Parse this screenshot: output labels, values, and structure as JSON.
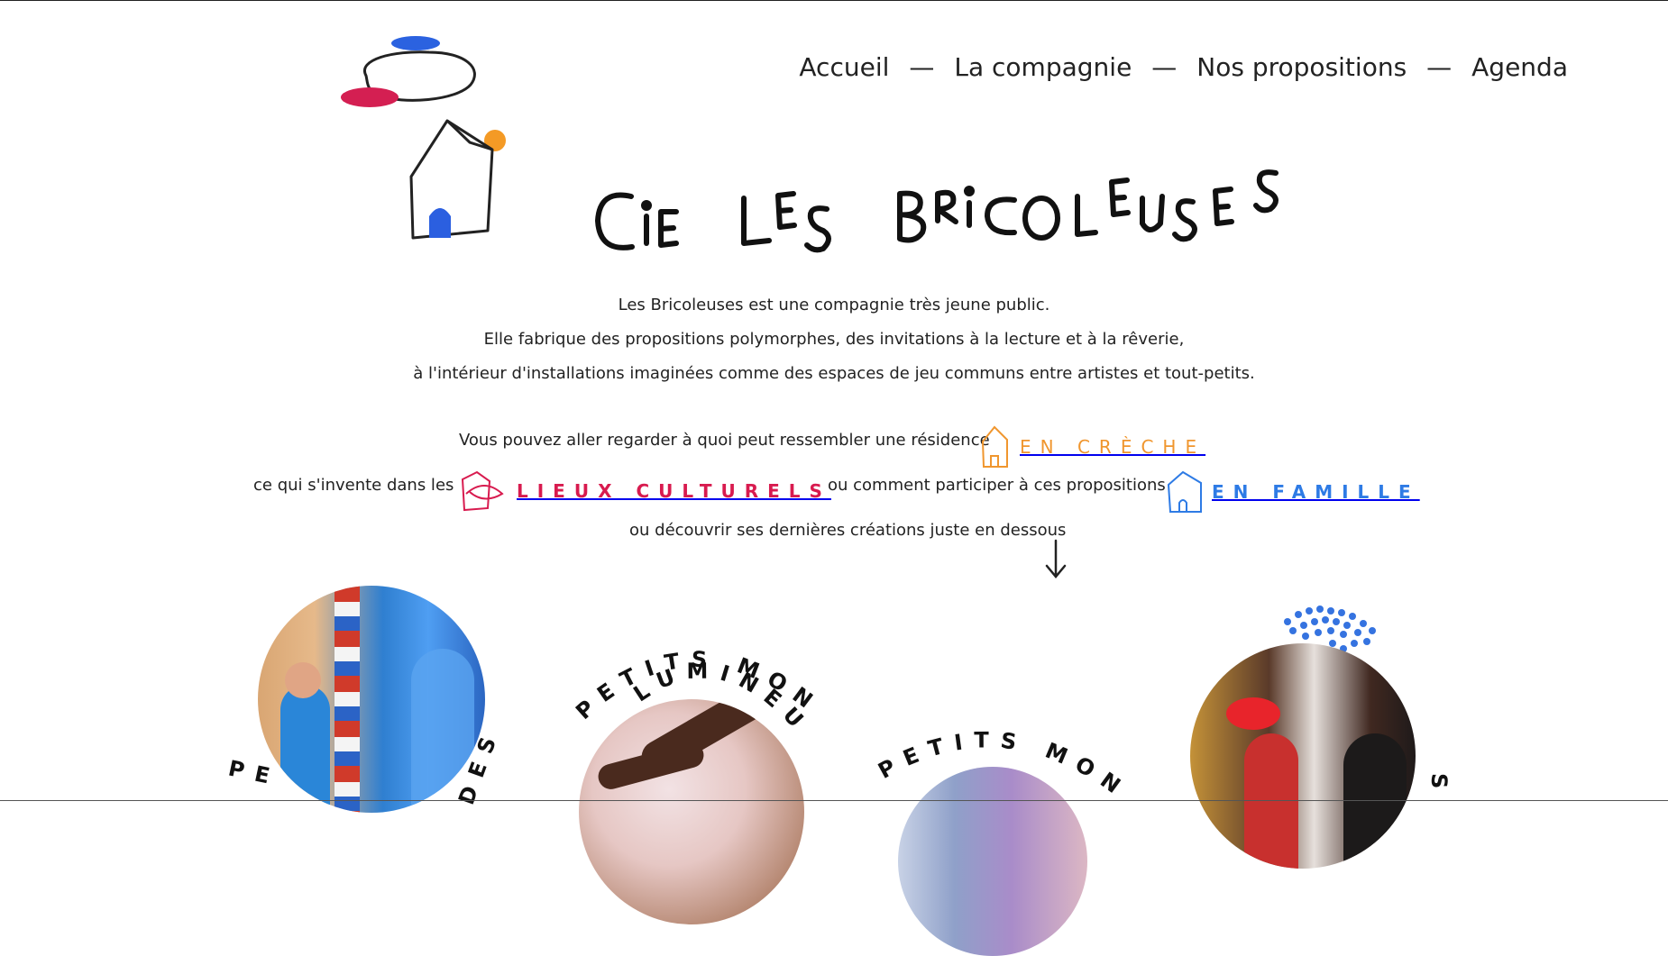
{
  "nav": {
    "items": [
      {
        "label": "Accueil"
      },
      {
        "label": "La compagnie"
      },
      {
        "label": "Nos propositions"
      },
      {
        "label": "Agenda"
      }
    ],
    "separator": "—"
  },
  "brand": {
    "name": "Cie Les Bricoleuses"
  },
  "intro": {
    "line1": "Les Bricoleuses est une compagnie très jeune public.",
    "line2": "Elle fabrique des propositions polymorphes, des invitations à la lecture et à la rêverie,",
    "line3": "à l'intérieur d'installations imaginées comme des espaces de jeu communs entre artistes et tout-petits."
  },
  "links": {
    "creche_intro": "Vous pouvez aller regarder à quoi peut ressembler une résidence",
    "creche_label": "EN CRÈCHE",
    "culturels_intro": "ce qui s'invente dans les",
    "culturels_label": "LIEUX CULTURELS",
    "famille_intro": "ou comment participer à ces propositions",
    "famille_label": "EN FAMILLE",
    "outro": "ou découvrir ses dernières créations juste en dessous"
  },
  "shows": [
    {
      "title_visible": "PE",
      "title_tail": "DES"
    },
    {
      "title_line1": "PETITS MONDES",
      "title_line2": "LUMINEUX"
    },
    {
      "title_visible": "PETITS MON"
    },
    {
      "title_tail": "S"
    }
  ],
  "colors": {
    "creche": "#f0962e",
    "culturels": "#d81b4f",
    "famille": "#2e7be5",
    "text": "#222222"
  }
}
